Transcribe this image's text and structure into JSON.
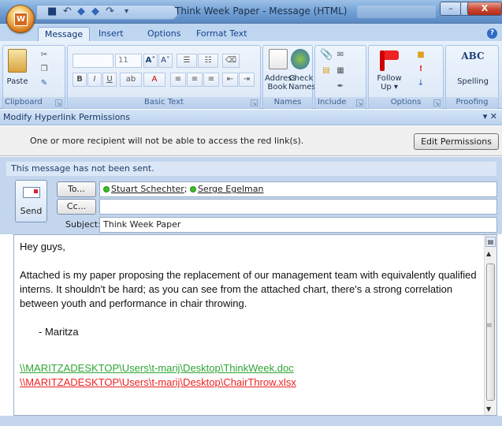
{
  "window": {
    "title": "Think Week Paper - Message (HTML)",
    "controls": {
      "minimize": "–",
      "maximize": "□",
      "close": "X"
    }
  },
  "quick_access": {
    "save": "■",
    "undo": "↶",
    "redo": "↷",
    "prev": "◆",
    "next": "◆",
    "more": "▾"
  },
  "tabs": [
    "Message",
    "Insert",
    "Options",
    "Format Text"
  ],
  "help": "?",
  "ribbon": {
    "clipboard": {
      "label": "Clipboard",
      "paste": "Paste"
    },
    "basic_text": {
      "label": "Basic Text",
      "font_size": "11",
      "bold": "B",
      "italic": "I",
      "underline": "U"
    },
    "names": {
      "label": "Names",
      "address_book": "Address\nBook",
      "check_names": "Check\nNames"
    },
    "include": {
      "label": "Include"
    },
    "options": {
      "label": "Options",
      "follow_up": "Follow\nUp ▾"
    },
    "proofing": {
      "label": "Proofing",
      "spelling": "Spelling",
      "abc": "ABC"
    }
  },
  "message_bar": {
    "title": "Modify Hyperlink Permissions",
    "controls": "▾ ✕",
    "text": "One or more recipient will not be able to access the red link(s).",
    "button": "Edit Permissions"
  },
  "header": {
    "not_sent": "This message has not been sent.",
    "send": "Send",
    "to_button": "To...",
    "cc_button": "Cc...",
    "subject_label": "Subject:",
    "recipients": [
      "Stuart Schechter",
      "Serge Egelman"
    ],
    "recipient_sep": ";",
    "cc_value": "",
    "subject": "Think Week Paper"
  },
  "body": {
    "greeting": "Hey guys,",
    "paragraph": "Attached is my paper proposing the replacement of our management team with equivalently qualified interns.  It shouldn't be hard; as you can see from the attached chart, there's a strong correlation between youth and performance in chair throwing.",
    "signature": "-   Maritza",
    "links": [
      {
        "text": "\\\\MARITZADESKTOP\\Users\\t-marij\\Desktop\\ThinkWeek.doc",
        "status": "accessible",
        "color": "#2ea535"
      },
      {
        "text": "\\\\MARITZADESKTOP\\Users\\t-marij\\Desktop\\ChairThrow.xlsx",
        "status": "restricted",
        "color": "#ee2222"
      }
    ]
  }
}
